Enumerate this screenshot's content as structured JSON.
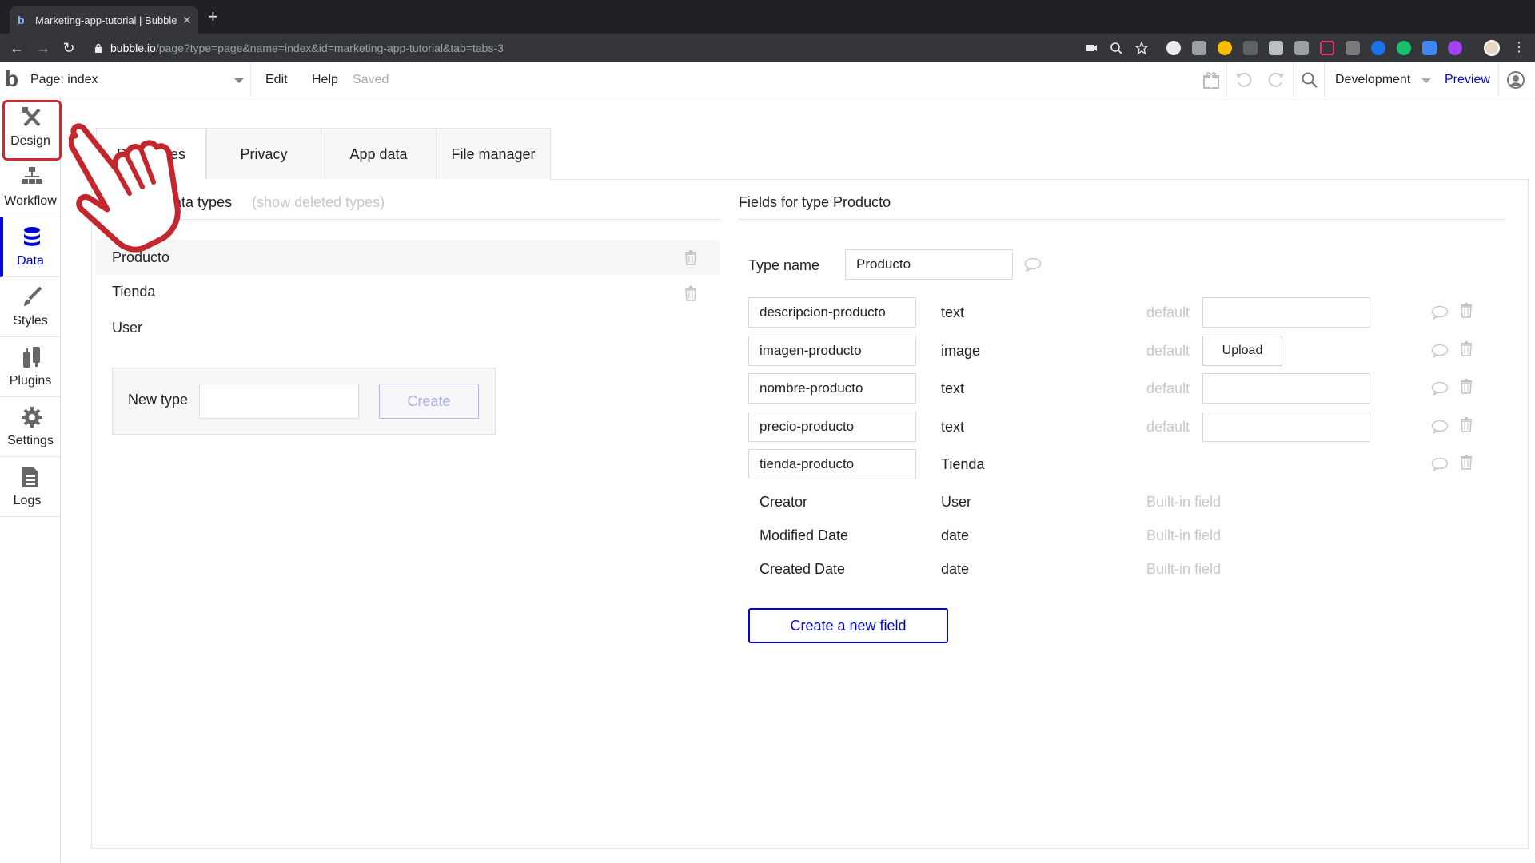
{
  "browser": {
    "tab_title": "Marketing-app-tutorial | Bubble",
    "url_host": "bubble.io",
    "url_path": "/page?type=page&name=index&id=marketing-app-tutorial&tab=tabs-3"
  },
  "editor": {
    "page_select": "Page: index",
    "menu": {
      "edit": "Edit",
      "help": "Help",
      "status": "Saved"
    },
    "environment": "Development",
    "preview": "Preview"
  },
  "sidebar": {
    "items": [
      {
        "label": "Design",
        "icon": "design-icon"
      },
      {
        "label": "Workflow",
        "icon": "workflow-icon"
      },
      {
        "label": "Data",
        "icon": "database-icon"
      },
      {
        "label": "Styles",
        "icon": "brush-icon"
      },
      {
        "label": "Plugins",
        "icon": "plugin-icon"
      },
      {
        "label": "Settings",
        "icon": "gear-icon"
      },
      {
        "label": "Logs",
        "icon": "document-icon"
      }
    ],
    "active": "Data",
    "highlighted": "Design"
  },
  "tabs": [
    {
      "label": "Data types"
    },
    {
      "label": "Privacy"
    },
    {
      "label": "App data"
    },
    {
      "label": "File manager"
    }
  ],
  "types_panel": {
    "title": "Custom data types",
    "show_deleted": "(show deleted types)",
    "types": [
      "Producto",
      "Tienda",
      "User"
    ],
    "new_type_label": "New type",
    "new_type_value": "",
    "create_label": "Create"
  },
  "fields_panel": {
    "title": "Fields for type Producto",
    "type_name_label": "Type name",
    "type_name_value": "Producto",
    "default_label": "default",
    "upload_label": "Upload",
    "fields": [
      {
        "name": "descripcion-producto",
        "type": "text",
        "has_default": true,
        "default_kind": "input"
      },
      {
        "name": "imagen-producto",
        "type": "image",
        "has_default": true,
        "default_kind": "upload"
      },
      {
        "name": "nombre-producto",
        "type": "text",
        "has_default": true,
        "default_kind": "input"
      },
      {
        "name": "precio-producto",
        "type": "text",
        "has_default": true,
        "default_kind": "input"
      },
      {
        "name": "tienda-producto",
        "type": "Tienda",
        "has_default": false
      }
    ],
    "builtin_label": "Built-in field",
    "builtin_fields": [
      {
        "name": "Creator",
        "type": "User"
      },
      {
        "name": "Modified Date",
        "type": "date"
      },
      {
        "name": "Created Date",
        "type": "date"
      }
    ],
    "create_field_label": "Create a new field"
  },
  "colors": {
    "accent": "#0205d3",
    "highlight": "#d0292f",
    "chrome_dark": "#202124"
  }
}
